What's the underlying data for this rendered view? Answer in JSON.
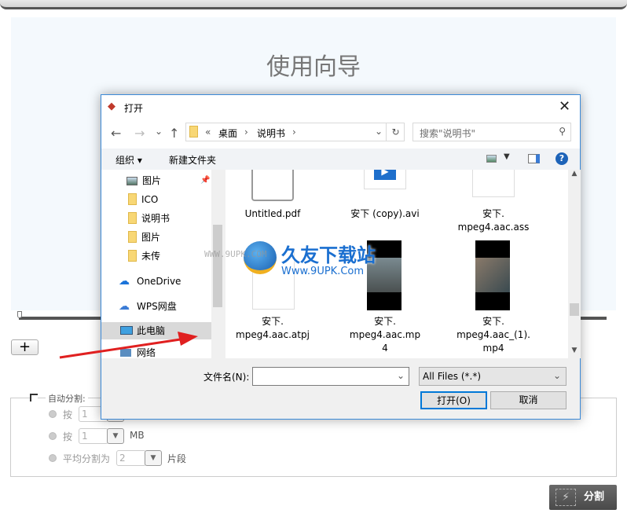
{
  "app": {
    "wizard_title": "使用向导",
    "add_label": "+",
    "auto_split_label": "自动分割:",
    "rows": [
      {
        "label": "按",
        "value": "1",
        "unit": ""
      },
      {
        "label": "按",
        "value": "1",
        "unit": "MB"
      },
      {
        "label": "平均分割为",
        "value": "2",
        "unit": "片段"
      }
    ],
    "split_label": "分割"
  },
  "dialog": {
    "title": "打开",
    "close": "✕",
    "nav": {
      "back": "←",
      "forward": "→",
      "recent": "⌄",
      "up": "↑",
      "refresh": "↻"
    },
    "breadcrumb": [
      "«",
      "桌面",
      "›",
      "说明书",
      "›"
    ],
    "search_placeholder": "搜索\"说明书\"",
    "toolbar": {
      "organize": "组织 ▾",
      "new_folder": "新建文件夹",
      "help": "?"
    },
    "nav_items": [
      {
        "label": "图片",
        "icon": "pictures-icon",
        "pinned": true
      },
      {
        "label": "ICO",
        "icon": "folder-icon"
      },
      {
        "label": "说明书",
        "icon": "folder-icon"
      },
      {
        "label": "图片",
        "icon": "folder-icon"
      },
      {
        "label": "未传",
        "icon": "folder-icon"
      },
      {
        "label": "OneDrive",
        "icon": "cloud-icon"
      },
      {
        "label": "WPS网盘",
        "icon": "wps-cloud-icon"
      },
      {
        "label": "此电脑",
        "icon": "computer-icon",
        "selected": true
      },
      {
        "label": "网络",
        "icon": "network-icon"
      }
    ],
    "files": [
      {
        "name": "Untitled.pdf"
      },
      {
        "name": "安下 (copy).avi"
      },
      {
        "name": "安下.\nmpeg4.aac.ass"
      },
      {
        "name": "安下.\nmpeg4.aac.atpj"
      },
      {
        "name": "安下.\nmpeg4.aac.mp\n4"
      },
      {
        "name": "安下.\nmpeg4.aac_(1).\nmp4"
      }
    ],
    "filename_label": "文件名(N):",
    "filename_value": "",
    "filter": "All Files (*.*)",
    "open": "打开(O)",
    "cancel": "取消"
  },
  "watermark": {
    "brand": "久友下载站",
    "url": "Www.9UPK.Com",
    "left_url": "WWW.9UPK.COM"
  },
  "colors": {
    "accent": "#0078d7",
    "arrow": "#e02020",
    "split_button": "#555555"
  }
}
